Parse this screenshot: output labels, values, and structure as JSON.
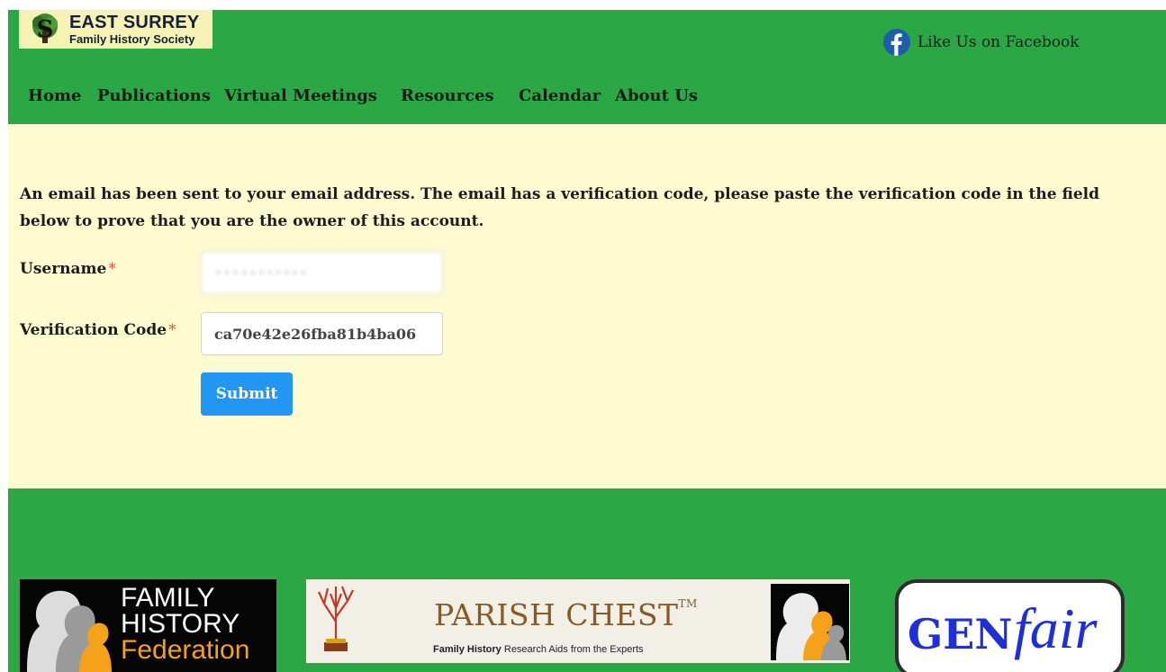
{
  "header": {
    "logo_title": "EAST SURREY",
    "logo_subtitle": "Family History Society",
    "facebook_label": "Like Us on Facebook",
    "nav": [
      "Home",
      "Publications",
      "Virtual Meetings",
      "Resources",
      "Calendar",
      "About Us"
    ]
  },
  "main": {
    "intro": "An email has been sent to your email address. The email has a verification code, please paste the verification code in the field below to prove that you are the owner of this account.",
    "username_label": "Username",
    "username_value": "•••••••••••",
    "verification_label": "Verification Code",
    "verification_value": "ca70e42e26fba81b4ba06",
    "required_marker": "*",
    "submit_label": "Submit"
  },
  "footer": {
    "fhf_line1": "FAMILY",
    "fhf_line2": "HISTORY",
    "fhf_line3": "Federation",
    "parish_chest_title": "PARISH CHEST",
    "parish_chest_tm": "TM",
    "parish_chest_sub_bold": "Family History",
    "parish_chest_sub_rest": " Research Aids from the Experts",
    "genfair_gen": "GEN",
    "genfair_fair": "fair"
  },
  "colors": {
    "header_green": "#2ba845",
    "content_cream": "#fffbd0",
    "submit_blue": "#2196f3",
    "required_red": "#e0553a",
    "facebook_blue": "#1c5fa8",
    "genfair_blue": "#1f2fd8"
  },
  "icons": {
    "facebook": "facebook-icon",
    "logo": "tree-logo-icon"
  }
}
